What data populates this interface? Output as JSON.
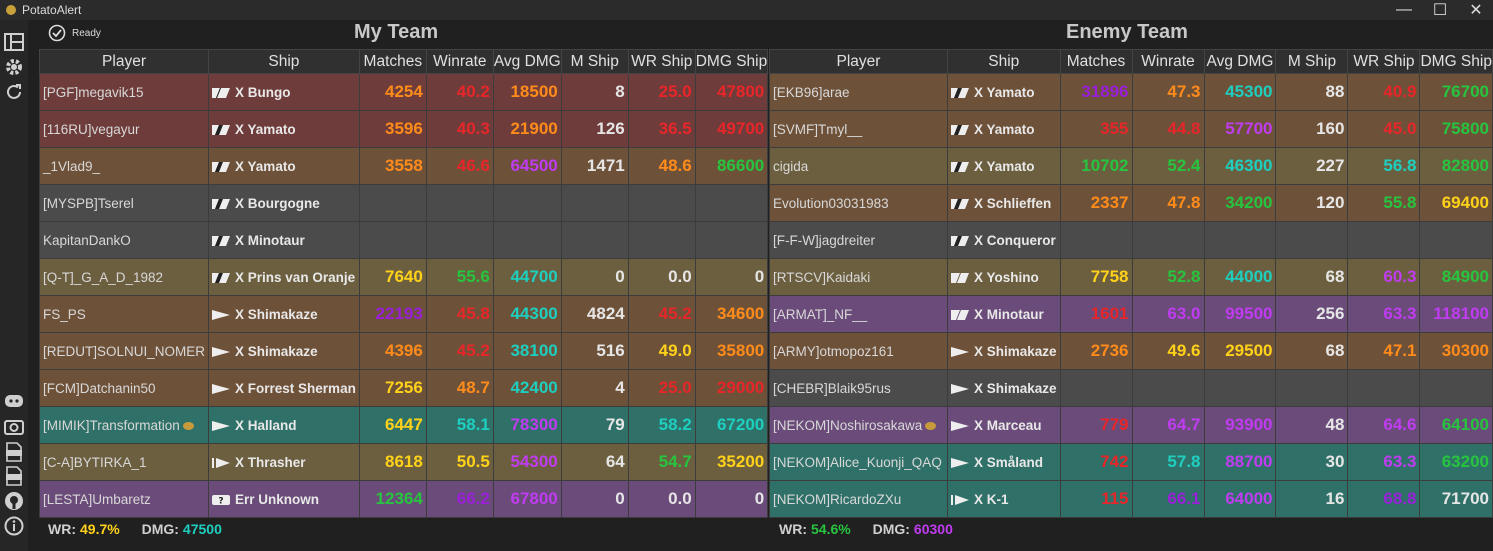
{
  "window": {
    "title": "PotatoAlert",
    "minimize_glyph": "—",
    "maximize_glyph": "☐",
    "close_glyph": "✕"
  },
  "status": {
    "text": "Ready",
    "icon": "check-circle-icon"
  },
  "sidebar": {
    "icons": [
      "table-icon",
      "gear-icon",
      "refresh-icon",
      "discord-icon",
      "screenshot-icon",
      "csv-icon",
      "log-icon",
      "github-icon",
      "info-icon"
    ]
  },
  "colors": {
    "red": "#e8262a",
    "orange": "#ff8c1a",
    "yellow": "#ffd21a",
    "green": "#27c43f",
    "cyan": "#1ecfc0",
    "purple": "#c03cf0",
    "violet": "#9a1fd8",
    "white": "#e6e6e6",
    "rows": {
      "red": "#6e3c3a",
      "brown": "#6e5139",
      "gray": "#4b4b4b",
      "olive": "#6c5f3f",
      "teal": "#2f7168",
      "purple": "#6a4b79"
    }
  },
  "headers": [
    "Player",
    "Ship",
    "Matches",
    "Winrate",
    "Avg DMG",
    "M Ship",
    "WR Ship",
    "DMG Ship"
  ],
  "my_team": {
    "title": "My Team",
    "rows": [
      {
        "player": "[PGF]megavik15",
        "ship": "X Bungo",
        "icon": "cv",
        "bg": "red",
        "matches": "4254",
        "mc": "orange",
        "winrate": "40.2",
        "wc": "red",
        "dmg": "18500",
        "dc": "orange",
        "mship": "8",
        "msc": "white",
        "wrship": "25.0",
        "wsc": "red",
        "dmgship": "47800",
        "dsc": "red"
      },
      {
        "player": "[116RU]vegayur",
        "ship": "X Yamato",
        "icon": "bb",
        "bg": "red",
        "matches": "3596",
        "mc": "orange",
        "winrate": "40.3",
        "wc": "red",
        "dmg": "21900",
        "dc": "orange",
        "mship": "126",
        "msc": "white",
        "wrship": "36.5",
        "wsc": "red",
        "dmgship": "49700",
        "dsc": "red"
      },
      {
        "player": "_1Vlad9_",
        "ship": "X Yamato",
        "icon": "bb",
        "bg": "brown",
        "matches": "3558",
        "mc": "orange",
        "winrate": "46.6",
        "wc": "red",
        "dmg": "64500",
        "dc": "purple",
        "mship": "1471",
        "msc": "white",
        "wrship": "48.6",
        "wsc": "orange",
        "dmgship": "86600",
        "dsc": "green"
      },
      {
        "player": "[MYSPB]Tserel",
        "ship": "X Bourgogne",
        "icon": "bb",
        "bg": "gray",
        "matches": "",
        "mc": "white",
        "winrate": "",
        "wc": "white",
        "dmg": "",
        "dc": "white",
        "mship": "",
        "msc": "white",
        "wrship": "",
        "wsc": "white",
        "dmgship": "",
        "dsc": "white"
      },
      {
        "player": "KapitanDankO",
        "ship": "X Minotaur",
        "icon": "bb",
        "bg": "gray",
        "matches": "",
        "mc": "white",
        "winrate": "",
        "wc": "white",
        "dmg": "",
        "dc": "white",
        "mship": "",
        "msc": "white",
        "wrship": "",
        "wsc": "white",
        "dmgship": "",
        "dsc": "white"
      },
      {
        "player": "[Q-T]_G_A_D_1982",
        "ship": "X Prins van Oranje",
        "icon": "bb",
        "bg": "olive",
        "matches": "7640",
        "mc": "yellow",
        "winrate": "55.6",
        "wc": "green",
        "dmg": "44700",
        "dc": "cyan",
        "mship": "0",
        "msc": "white",
        "wrship": "0.0",
        "wsc": "white",
        "dmgship": "0",
        "dsc": "white"
      },
      {
        "player": "FS_PS",
        "ship": "X Shimakaze",
        "icon": "dd",
        "bg": "brown",
        "matches": "22193",
        "mc": "violet",
        "winrate": "45.8",
        "wc": "red",
        "dmg": "44300",
        "dc": "cyan",
        "mship": "4824",
        "msc": "white",
        "wrship": "45.2",
        "wsc": "red",
        "dmgship": "34600",
        "dsc": "orange"
      },
      {
        "player": "[REDUT]SOLNUI_NOMER",
        "ship": "X Shimakaze",
        "icon": "dd",
        "bg": "brown",
        "matches": "4396",
        "mc": "orange",
        "winrate": "45.2",
        "wc": "red",
        "dmg": "38100",
        "dc": "cyan",
        "mship": "516",
        "msc": "white",
        "wrship": "49.0",
        "wsc": "yellow",
        "dmgship": "35800",
        "dsc": "orange"
      },
      {
        "player": "[FCM]Datchanin50",
        "ship": "X Forrest Sherman",
        "icon": "dd",
        "bg": "brown",
        "matches": "7256",
        "mc": "yellow",
        "winrate": "48.7",
        "wc": "orange",
        "dmg": "42400",
        "dc": "cyan",
        "mship": "4",
        "msc": "white",
        "wrship": "25.0",
        "wsc": "red",
        "dmgship": "29000",
        "dsc": "red"
      },
      {
        "player": "[MIMIK]Transformation",
        "coin": true,
        "ship": "X Halland",
        "icon": "dd",
        "bg": "teal",
        "matches": "6447",
        "mc": "yellow",
        "winrate": "58.1",
        "wc": "cyan",
        "dmg": "78300",
        "dc": "purple",
        "mship": "79",
        "msc": "white",
        "wrship": "58.2",
        "wsc": "cyan",
        "dmgship": "67200",
        "dsc": "cyan"
      },
      {
        "player": "[C-A]BYTIRKA_1",
        "ship": "X Thrasher",
        "icon": "dd2",
        "bg": "olive",
        "matches": "8618",
        "mc": "yellow",
        "winrate": "50.5",
        "wc": "yellow",
        "dmg": "54300",
        "dc": "purple",
        "mship": "64",
        "msc": "white",
        "wrship": "54.7",
        "wsc": "green",
        "dmgship": "35200",
        "dsc": "yellow"
      },
      {
        "player": "[LESTA]Umbaretz",
        "ship": "Err Unknown",
        "icon": "unknown",
        "bg": "purple",
        "matches": "12364",
        "mc": "green",
        "winrate": "66.2",
        "wc": "violet",
        "dmg": "67800",
        "dc": "purple",
        "mship": "0",
        "msc": "white",
        "wrship": "0.0",
        "wsc": "white",
        "dmgship": "0",
        "dsc": "white"
      }
    ],
    "footer": {
      "wr_label": "WR:",
      "wr": "49.7%",
      "dmg_label": "DMG:",
      "dmg": "47500"
    }
  },
  "enemy_team": {
    "title": "Enemy Team",
    "rows": [
      {
        "player": "[EKB96]arae",
        "ship": "X Yamato",
        "icon": "bb",
        "bg": "brown",
        "matches": "31896",
        "mc": "violet",
        "winrate": "47.3",
        "wc": "orange",
        "dmg": "45300",
        "dc": "cyan",
        "mship": "88",
        "msc": "white",
        "wrship": "40.9",
        "wsc": "red",
        "dmgship": "76700",
        "dsc": "green"
      },
      {
        "player": "[SVMF]Tmyl__",
        "ship": "X Yamato",
        "icon": "bb",
        "bg": "brown",
        "matches": "355",
        "mc": "red",
        "winrate": "44.8",
        "wc": "red",
        "dmg": "57700",
        "dc": "purple",
        "mship": "160",
        "msc": "white",
        "wrship": "45.0",
        "wsc": "red",
        "dmgship": "75800",
        "dsc": "green"
      },
      {
        "player": "cigida",
        "ship": "X Yamato",
        "icon": "bb",
        "bg": "olive",
        "matches": "10702",
        "mc": "green",
        "winrate": "52.4",
        "wc": "green",
        "dmg": "46300",
        "dc": "cyan",
        "mship": "227",
        "msc": "white",
        "wrship": "56.8",
        "wsc": "cyan",
        "dmgship": "82800",
        "dsc": "green"
      },
      {
        "player": "Evolution03031983",
        "ship": "X Schlieffen",
        "icon": "bb",
        "bg": "brown",
        "matches": "2337",
        "mc": "orange",
        "winrate": "47.8",
        "wc": "orange",
        "dmg": "34200",
        "dc": "green",
        "mship": "120",
        "msc": "white",
        "wrship": "55.8",
        "wsc": "green",
        "dmgship": "69400",
        "dsc": "yellow"
      },
      {
        "player": "[F-F-W]jagdreiter",
        "ship": "X Conqueror",
        "icon": "bb",
        "bg": "gray",
        "matches": "",
        "mc": "white",
        "winrate": "",
        "wc": "white",
        "dmg": "",
        "dc": "white",
        "mship": "",
        "msc": "white",
        "wrship": "",
        "wsc": "white",
        "dmgship": "",
        "dsc": "white"
      },
      {
        "player": "[RTSCV]Kaidaki",
        "ship": "X Yoshino",
        "icon": "ca",
        "bg": "olive",
        "matches": "7758",
        "mc": "yellow",
        "winrate": "52.8",
        "wc": "green",
        "dmg": "44000",
        "dc": "cyan",
        "mship": "68",
        "msc": "white",
        "wrship": "60.3",
        "wsc": "purple",
        "dmgship": "84900",
        "dsc": "green"
      },
      {
        "player": "[ARMAT]_NF__",
        "ship": "X Minotaur",
        "icon": "ca",
        "bg": "purple",
        "matches": "1601",
        "mc": "red",
        "winrate": "63.0",
        "wc": "purple",
        "dmg": "99500",
        "dc": "purple",
        "mship": "256",
        "msc": "white",
        "wrship": "63.3",
        "wsc": "purple",
        "dmgship": "118100",
        "dsc": "purple"
      },
      {
        "player": "[ARMY]otmopoz161",
        "ship": "X Shimakaze",
        "icon": "dd",
        "bg": "brown",
        "matches": "2736",
        "mc": "orange",
        "winrate": "49.6",
        "wc": "yellow",
        "dmg": "29500",
        "dc": "yellow",
        "mship": "68",
        "msc": "white",
        "wrship": "47.1",
        "wsc": "orange",
        "dmgship": "30300",
        "dsc": "orange"
      },
      {
        "player": "[CHEBR]Blaik95rus",
        "ship": "X Shimakaze",
        "icon": "dd",
        "bg": "gray",
        "matches": "",
        "mc": "white",
        "winrate": "",
        "wc": "white",
        "dmg": "",
        "dc": "white",
        "mship": "",
        "msc": "white",
        "wrship": "",
        "wsc": "white",
        "dmgship": "",
        "dsc": "white"
      },
      {
        "player": "[NEKOM]Noshirosakawa",
        "coin": true,
        "ship": "X Marceau",
        "icon": "dd",
        "bg": "purple",
        "matches": "779",
        "mc": "red",
        "winrate": "64.7",
        "wc": "purple",
        "dmg": "93900",
        "dc": "purple",
        "mship": "48",
        "msc": "white",
        "wrship": "64.6",
        "wsc": "purple",
        "dmgship": "64100",
        "dsc": "green"
      },
      {
        "player": "[NEKOM]Alice_Kuonji_QAQ",
        "ship": "X Småland",
        "icon": "dd",
        "bg": "teal",
        "matches": "742",
        "mc": "red",
        "winrate": "57.8",
        "wc": "cyan",
        "dmg": "88700",
        "dc": "purple",
        "mship": "30",
        "msc": "white",
        "wrship": "63.3",
        "wsc": "purple",
        "dmgship": "63200",
        "dsc": "green"
      },
      {
        "player": "[NEKOM]RicardoZXu",
        "ship": "X K-1",
        "icon": "dd2",
        "bg": "teal",
        "matches": "115",
        "mc": "red",
        "winrate": "66.1",
        "wc": "violet",
        "dmg": "64000",
        "dc": "purple",
        "mship": "16",
        "msc": "white",
        "wrship": "68.8",
        "wsc": "violet",
        "dmgship": "71700",
        "dsc": "white"
      }
    ],
    "footer": {
      "wr_label": "WR:",
      "wr": "54.6%",
      "dmg_label": "DMG:",
      "dmg": "60300"
    }
  }
}
